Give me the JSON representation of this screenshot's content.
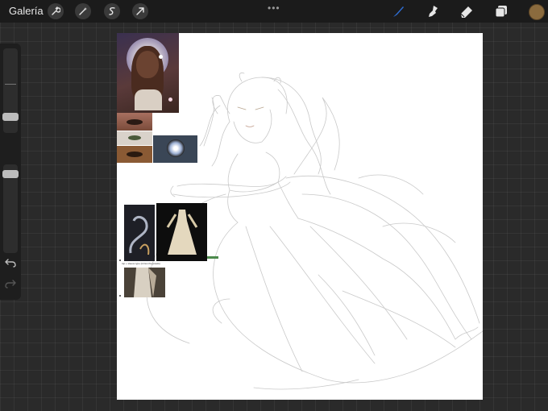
{
  "toolbar": {
    "gallery_label": "Galería",
    "left_tools": [
      "wrench-icon",
      "magic-wand-icon",
      "selection-icon",
      "transform-arrow-icon"
    ],
    "right_tools": [
      "brush-icon",
      "smudge-icon",
      "eraser-icon",
      "layers-icon"
    ],
    "active_tool": "brush-icon",
    "accent_color": "#2f6fd6",
    "current_color": "#8b6b3e",
    "more_indicator": "•••"
  },
  "sidebar": {
    "brush_size_level": 0.3,
    "opacity_level": 0.55,
    "undo_icon": "undo-icon",
    "redo_icon": "redo-icon"
  },
  "canvas": {
    "background": "#ffffff",
    "reference_note": "top + sleeve type (minus the jewels)"
  }
}
